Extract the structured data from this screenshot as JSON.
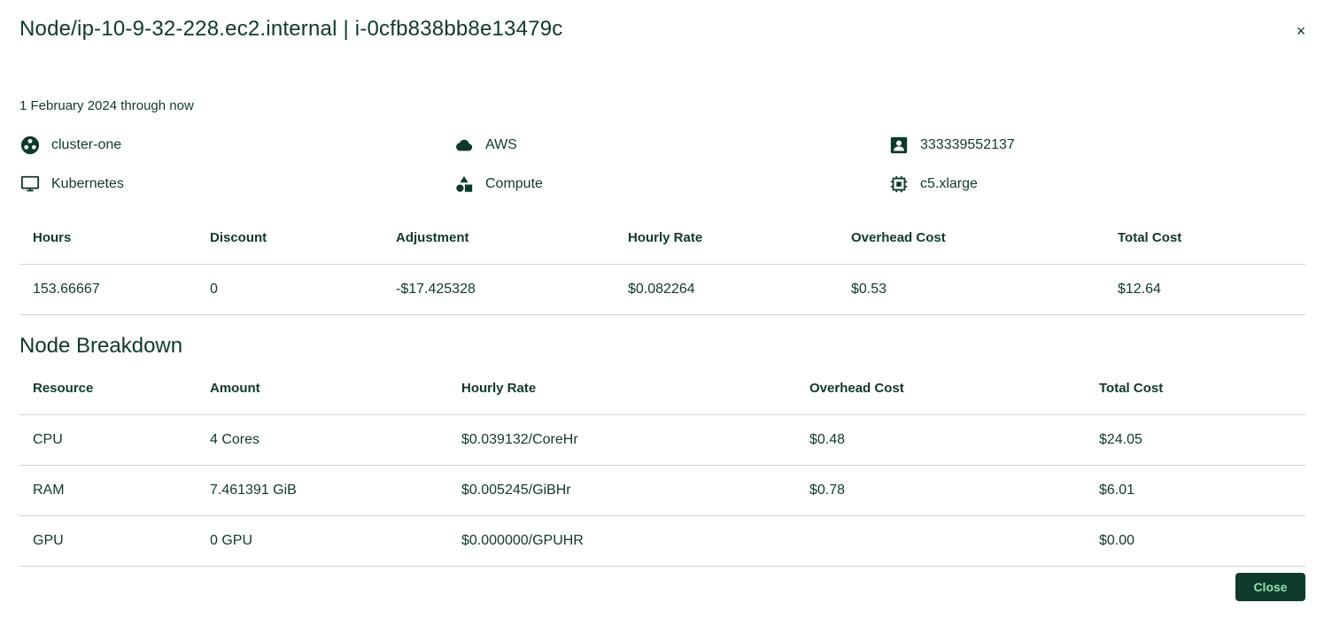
{
  "dialog": {
    "title": "Node/ip-10-9-32-228.ec2.internal | i-0cfb838bb8e13479c",
    "close_icon": "×",
    "date_range": "1 February 2024 through now"
  },
  "meta": {
    "cluster": {
      "icon": "cluster-icon",
      "label": "cluster-one"
    },
    "provider": {
      "icon": "cloud-icon",
      "label": "AWS"
    },
    "account": {
      "icon": "account-icon",
      "label": "333339552137"
    },
    "platform": {
      "icon": "monitor-icon",
      "label": "Kubernetes"
    },
    "category": {
      "icon": "shapes-icon",
      "label": "Compute"
    },
    "instance_type": {
      "icon": "chip-icon",
      "label": "c5.xlarge"
    }
  },
  "summary": {
    "headers": [
      "Hours",
      "Discount",
      "Adjustment",
      "Hourly Rate",
      "Overhead Cost",
      "Total Cost"
    ],
    "row": [
      "153.66667",
      "0",
      "-$17.425328",
      "$0.082264",
      "$0.53",
      "$12.64"
    ]
  },
  "breakdown": {
    "title": "Node Breakdown",
    "headers": [
      "Resource",
      "Amount",
      "Hourly Rate",
      "Overhead Cost",
      "Total Cost"
    ],
    "rows": [
      [
        "CPU",
        "4 Cores",
        "$0.039132/CoreHr",
        "$0.48",
        "$24.05"
      ],
      [
        "RAM",
        "7.461391 GiB",
        "$0.005245/GiBHr",
        "$0.78",
        "$6.01"
      ],
      [
        "GPU",
        "0 GPU",
        "$0.000000/GPUHR",
        "",
        "$0.00"
      ]
    ]
  },
  "footer": {
    "close_label": "Close"
  },
  "colors": {
    "primary": "#0d3a2b",
    "button_text": "#8ee5a8",
    "divider": "#cfd5d2"
  }
}
